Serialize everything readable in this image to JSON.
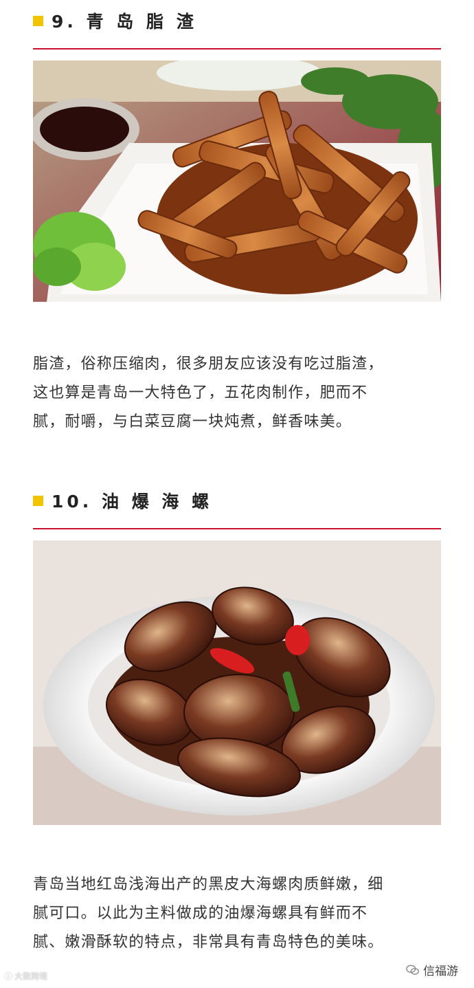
{
  "sections": [
    {
      "title": "9. 青 岛 脂 渣",
      "photo_subject": "fried-pork-strips-photo",
      "paragraph": [
        "脂渣，俗称压缩肉，很多朋友应该没有吃过脂渣，",
        "这也算是青岛一大特色了，五花肉制作，肥而不",
        "腻，耐嚼，与白菜豆腐一块炖煮，鲜香味美。"
      ]
    },
    {
      "title": "10. 油 爆 海 螺",
      "photo_subject": "braised-sea-snails-photo",
      "paragraph": [
        "青岛当地红岛浅海出产的黑皮大海螺肉质鲜嫩，细",
        "腻可口。以此为主料做成的油爆海螺具有鲜而不",
        "腻、嫩滑酥软的特点，非常具有青岛特色的美味。"
      ]
    }
  ],
  "watermark_left": "大数跨境",
  "watermark_right": "信福游",
  "colors": {
    "title_marker": "#f2c400",
    "divider": "#c8102e",
    "body_text": "#333333"
  }
}
